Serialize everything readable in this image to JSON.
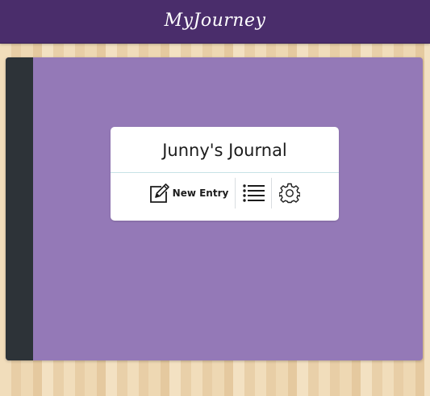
{
  "header": {
    "title": "MyJourney"
  },
  "journal": {
    "title": "Junny's Journal",
    "actions": {
      "new_entry_label": "New Entry",
      "new_entry_icon": "edit-icon",
      "list_icon": "list-icon",
      "settings_icon": "gear-icon"
    }
  },
  "colors": {
    "header_bg": "#4a2d6b",
    "book_cover": "#9479b7",
    "book_spine": "#2d3338",
    "card_bg": "#ffffff"
  }
}
